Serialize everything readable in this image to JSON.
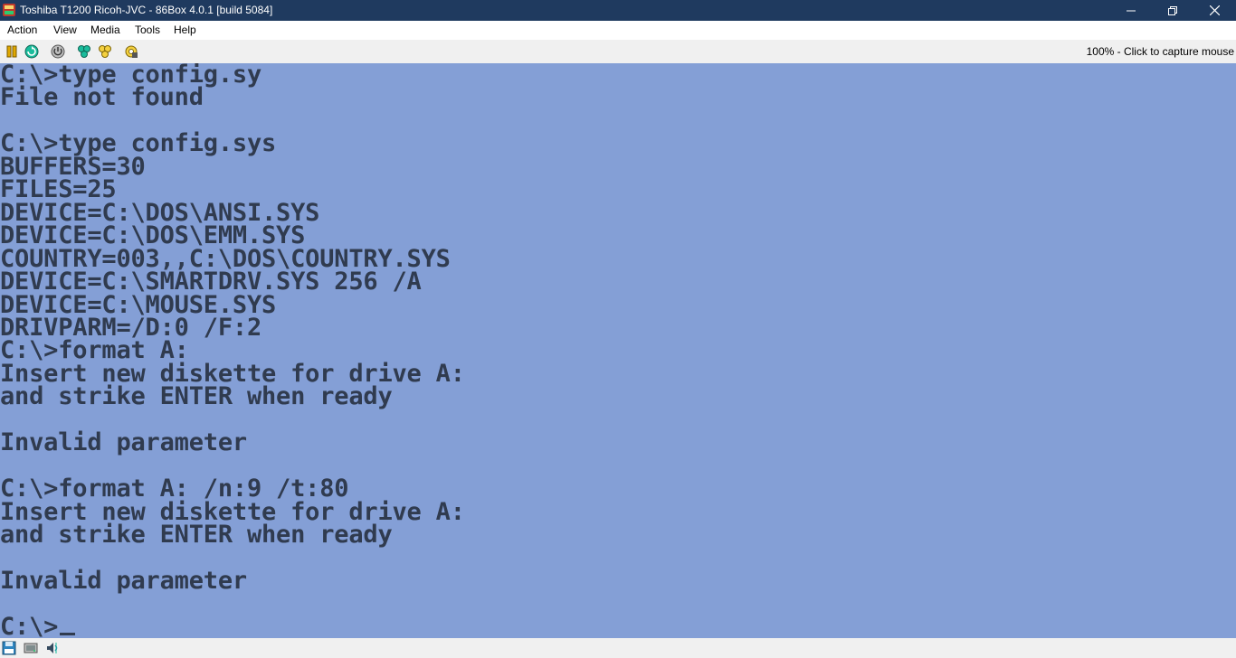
{
  "window": {
    "title": "Toshiba T1200 Ricoh-JVC - 86Box 4.0.1 [build 5084]",
    "icon": "86box-app-icon",
    "controls": [
      "minimize-icon",
      "restore-icon",
      "close-icon"
    ]
  },
  "menu": {
    "items": [
      "Action",
      "View",
      "Media",
      "Tools",
      "Help"
    ]
  },
  "toolbar": {
    "icons": [
      "pause-icon",
      "reset-icon",
      "power-icon",
      "ctrl-alt-del-icon",
      "ctrl-alt-esc-icon",
      "settings-icon"
    ],
    "capture_message": "100% - Click to capture mouse"
  },
  "screen": {
    "background": "#849fd6",
    "text_color": "#303b4f",
    "lines": [
      "C:\\>type config.sy",
      "File not found",
      "",
      "C:\\>type config.sys",
      "BUFFERS=30",
      "FILES=25",
      "DEVICE=C:\\DOS\\ANSI.SYS",
      "DEVICE=C:\\DOS\\EMM.SYS",
      "COUNTRY=003,,C:\\DOS\\COUNTRY.SYS",
      "DEVICE=C:\\SMARTDRV.SYS 256 /A",
      "DEVICE=C:\\MOUSE.SYS",
      "DRIVPARM=/D:0 /F:2",
      "C:\\>format A:",
      "Insert new diskette for drive A:",
      "and strike ENTER when ready",
      "",
      "Invalid parameter",
      "",
      "C:\\>format A: /n:9 /t:80",
      "Insert new diskette for drive A:",
      "and strike ENTER when ready",
      "",
      "Invalid parameter",
      "",
      "C:\\>"
    ]
  },
  "statusbar": {
    "icons": [
      "floppy-drive-icon",
      "hard-disk-icon",
      "sound-icon"
    ]
  }
}
